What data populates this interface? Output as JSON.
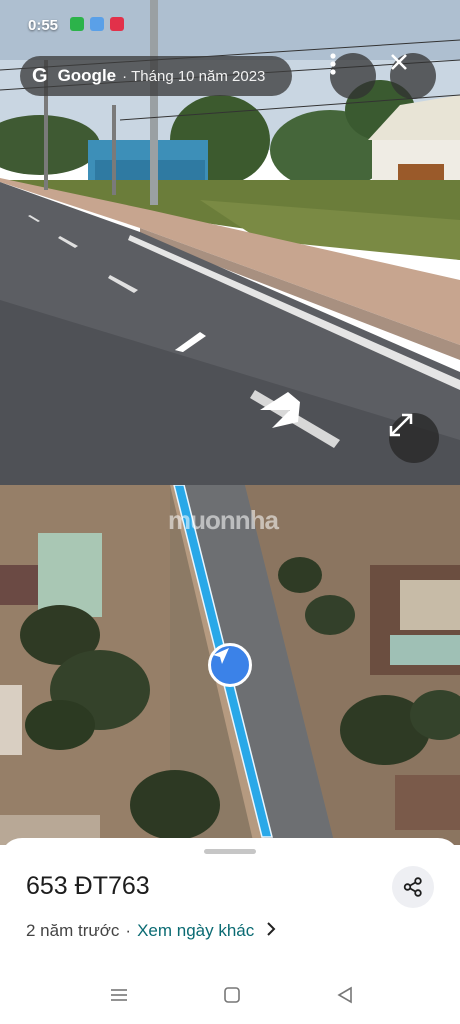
{
  "status_bar": {
    "time": "0:55"
  },
  "header": {
    "logo": "G",
    "brand": "Google",
    "separator": "·",
    "date": "Tháng 10 năm 2023"
  },
  "icons": {
    "menu": "vertical-dots-icon",
    "close": "close-icon",
    "expand": "expand-icon",
    "share": "share-icon",
    "location": "navigation-arrow-icon"
  },
  "map": {
    "watermark": "muonnha"
  },
  "sheet": {
    "address": "653 ĐT763",
    "age": "2 năm trước",
    "separator": "·",
    "other_dates": "Xem ngày khác"
  },
  "colors": {
    "route": "#29a8e8",
    "location_dot": "#3b82e8",
    "link": "#0b6b73"
  }
}
